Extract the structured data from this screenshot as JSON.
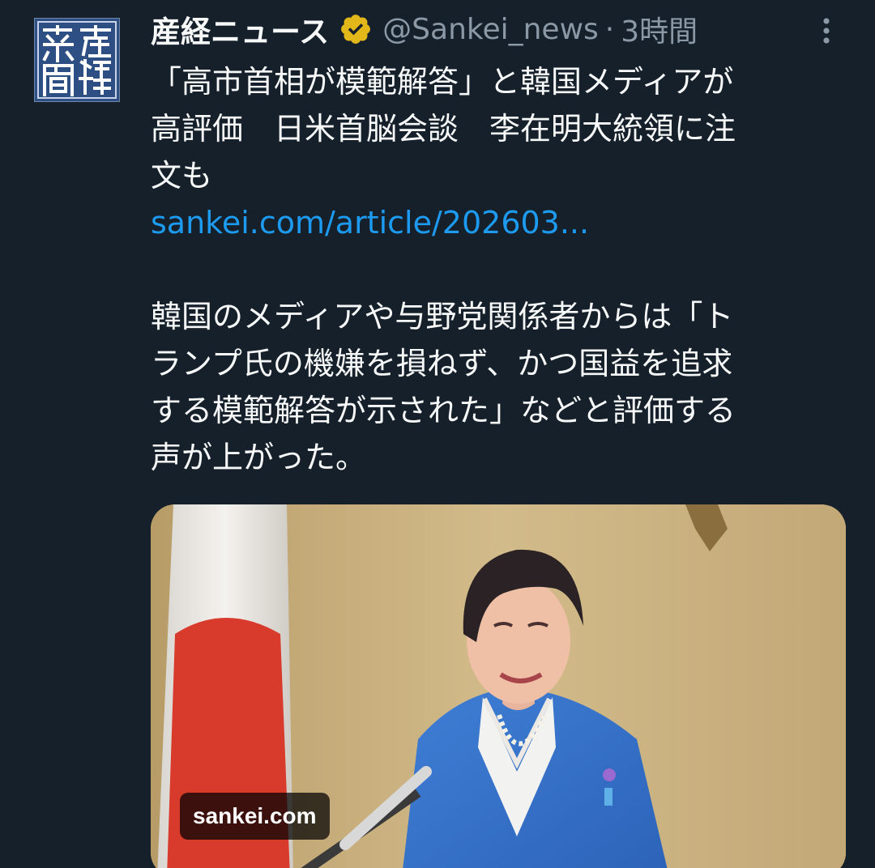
{
  "tweet": {
    "display_name": "産経ニュース",
    "handle": "@Sankei_news",
    "separator": "·",
    "time": "3時間",
    "headline": "「高市首相が模範解答」と韓国メディアが\n高評価　日米首脳会談　李在明大統領に注\n文も",
    "link": "sankei.com/article/202603...",
    "body": "韓国のメディアや与野党関係者からは「ト\nランプ氏の機嫌を損ねず、かつ国益を追求\nする模範解答が示された」などと評価する\n声が上がった。"
  },
  "avatar": {
    "logo_text": "産經新聞"
  },
  "media": {
    "domain_label": "sankei.com"
  },
  "icons": {
    "verified": "verified-badge-icon",
    "more": "more-vertical-icon"
  },
  "colors": {
    "background": "#15202b",
    "text": "#f7f9f9",
    "secondary": "#8b98a5",
    "link": "#1d9bf0",
    "verified": "#e2b719"
  }
}
